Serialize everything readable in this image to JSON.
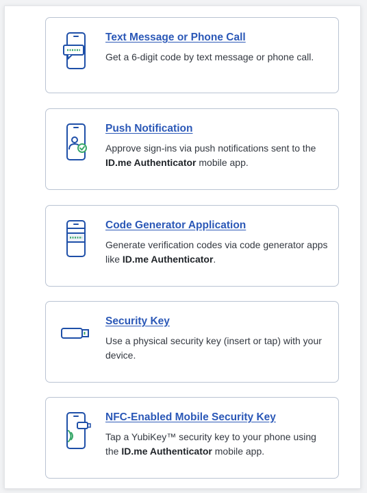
{
  "options": [
    {
      "title": "Text Message or Phone Call",
      "desc_parts": [
        "Get a 6-digit code by text message or phone call."
      ],
      "icon": "phone-message-icon"
    },
    {
      "title": "Push Notification",
      "desc_parts": [
        "Approve sign-ins via push notifications sent to the ",
        "ID.me Authenticator",
        " mobile app."
      ],
      "icon": "push-notification-phone-icon"
    },
    {
      "title": "Code Generator Application",
      "desc_parts": [
        "Generate verification codes via code generator apps like ",
        "ID.me Authenticator",
        "."
      ],
      "icon": "code-generator-phone-icon"
    },
    {
      "title": "Security Key",
      "desc_parts": [
        "Use a physical security key (insert or tap) with your device."
      ],
      "icon": "usb-security-key-icon"
    },
    {
      "title": "NFC-Enabled Mobile Security Key",
      "desc_parts": [
        "Tap a YubiKey™ security key to your phone using the ",
        "ID.me Authenticator",
        " mobile app."
      ],
      "icon": "nfc-phone-key-icon"
    }
  ],
  "colors": {
    "link": "#2b58b7",
    "icon_stroke": "#1e4fa8",
    "icon_accent": "#3aa86a",
    "card_border": "#b9c3d2"
  }
}
